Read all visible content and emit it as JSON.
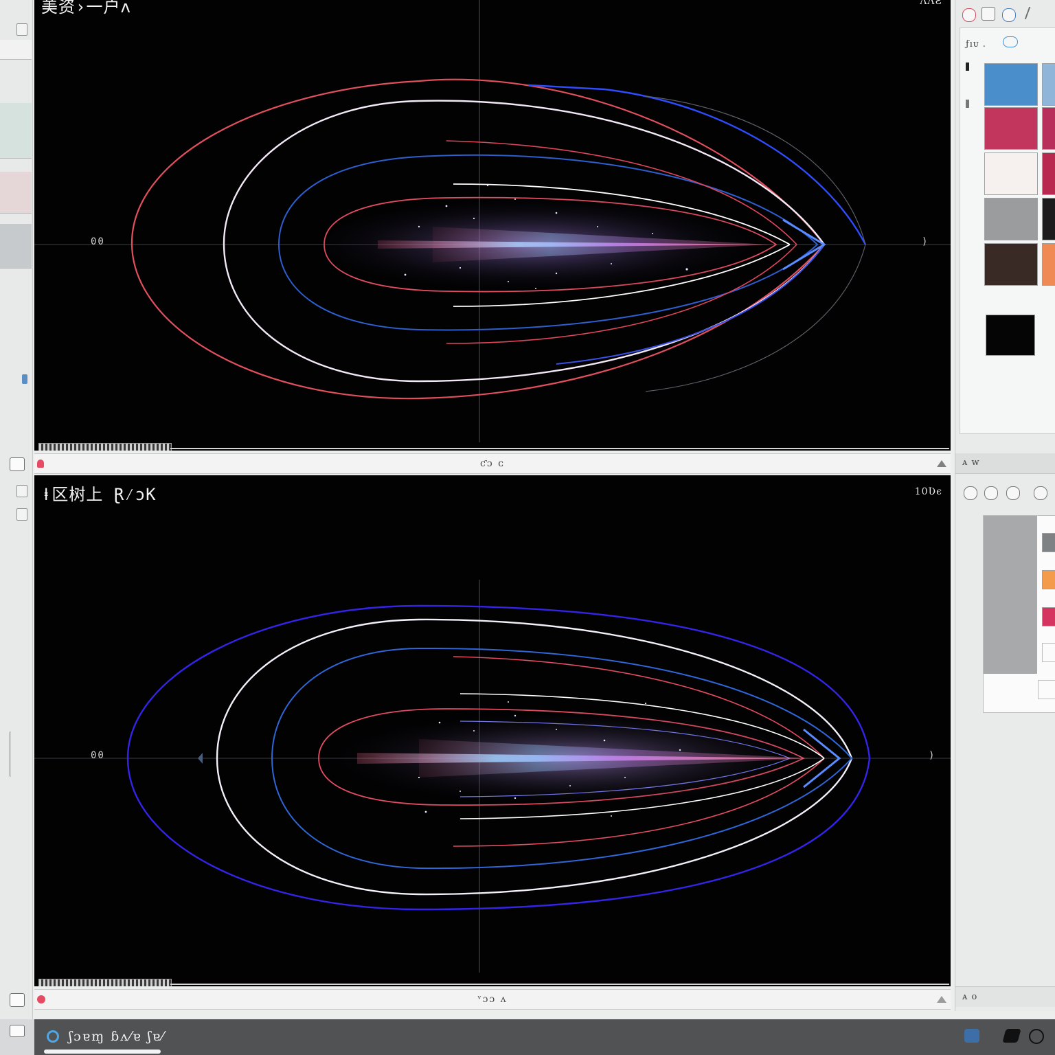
{
  "top_view": {
    "title": "美资›一户ʌ",
    "zoom": "ɅɅƧ",
    "axis_origin_label": "00",
    "axis_end_label": ")",
    "footer_text": "ƈɔ ᴄ"
  },
  "bottom_view": {
    "title": "ⱡ区树上 Ɽ⁄ɔK",
    "zoom": "10Ʋє",
    "axis_origin_label": "00",
    "axis_end_label": ")",
    "footer_text": "ᵛɔɔ ʌ"
  },
  "right_panel": {
    "header_text": "ƒıᴜ .",
    "tab_label": "ᴀ ᴡ",
    "footer_label": "ᴀ ᴏ",
    "swatches": [
      "#4a8fcc",
      "#c2365e",
      "#f6f1ef",
      "#9b9c9d",
      "#3a2a25",
      "#050505"
    ],
    "extra_swatches": [
      "#8fb5d8",
      "#b92f5c",
      "#b8284f",
      "#1d1b1c",
      "#f08a54"
    ],
    "lower_swatches": [
      "#7f8284",
      "#f39b4a",
      "#d4345f"
    ],
    "tool_icons": [
      "record-icon",
      "stop-icon",
      "loop-icon",
      "pen-icon"
    ],
    "grey_block_color": "#a8a9aa"
  },
  "taskbar": {
    "app_label": "ʃɔɐɱ ɓʌ⁄ɐ ʃɐ⁄"
  }
}
